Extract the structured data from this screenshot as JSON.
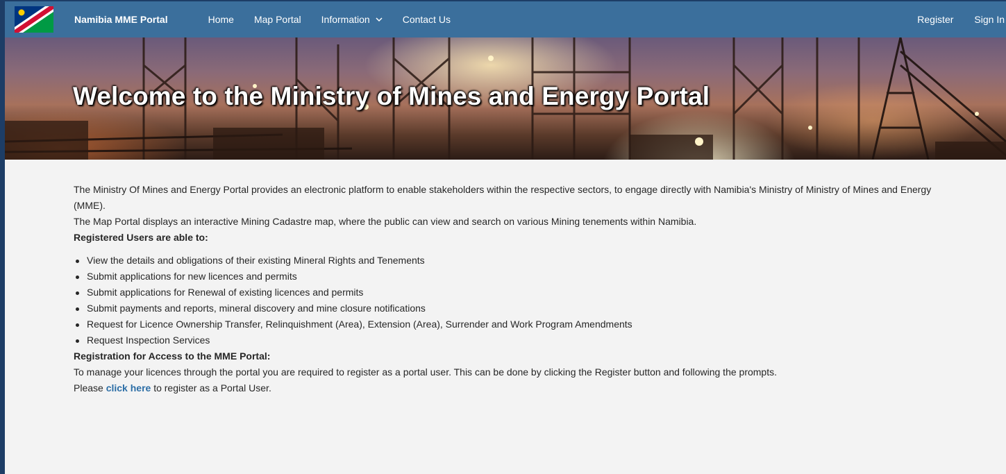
{
  "navbar": {
    "brand": "Namibia MME Portal",
    "links": [
      {
        "label": "Home"
      },
      {
        "label": "Map Portal"
      },
      {
        "label": "Information"
      },
      {
        "label": "Contact Us"
      }
    ],
    "right_links": [
      {
        "label": "Register"
      },
      {
        "label": "Sign In"
      }
    ],
    "colors": {
      "background": "#3b6f9c",
      "frame": "#1d3d66"
    },
    "icons": {
      "logo": "namibia-flag-icon",
      "dropdown": "chevron-down-icon"
    }
  },
  "hero": {
    "title": "Welcome to the Ministry of Mines and Energy Portal"
  },
  "content": {
    "intro_lines": [
      "The Ministry Of Mines and Energy Portal provides an electronic platform to enable stakeholders within the respective sectors, to engage directly with Namibia's Ministry of Ministry of Mines and Energy (MME).",
      "The Map Portal displays an interactive Mining Cadastre map, where the public can view and search on various Mining tenements within Namibia."
    ],
    "registered_heading": "Registered Users are able to:",
    "registered_items": [
      "View the details and obligations of their existing Mineral Rights and Tenements",
      "Submit applications for new licences and permits",
      "Submit applications for Renewal of existing licences and permits",
      "Submit payments and reports, mineral discovery and mine closure notifications",
      "Request for Licence Ownership Transfer, Relinquishment (Area), Extension (Area), Surrender and Work Program Amendments",
      "Request Inspection Services"
    ],
    "registration_heading": "Registration for Access to the MME Portal:",
    "registration_text": "To manage your licences through the portal you are required to register as a portal user. This can be done by clicking the Register button and following the prompts.",
    "please_prefix": "Please ",
    "click_here": "click here",
    "please_suffix": " to register as a Portal User.",
    "colors": {
      "link": "#2c6ea6"
    }
  }
}
